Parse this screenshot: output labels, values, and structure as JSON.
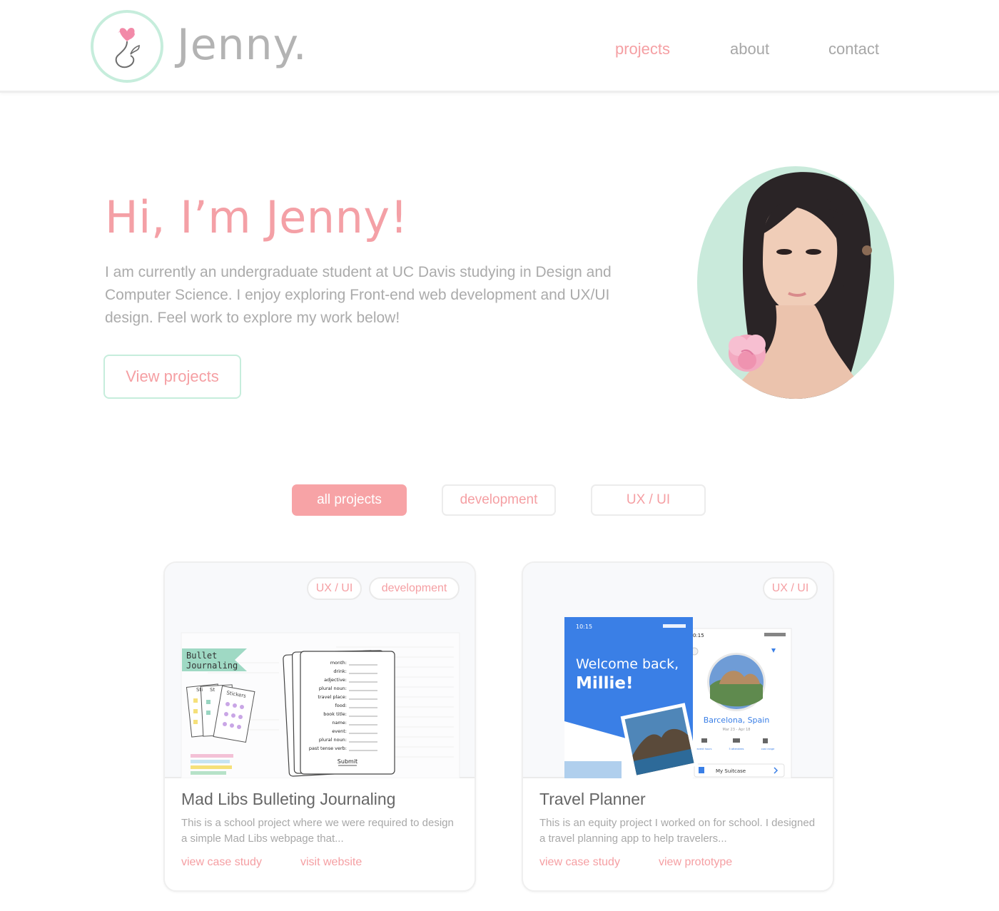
{
  "header": {
    "logo_text": "Jenny.",
    "nav": [
      "projects",
      "about",
      "contact"
    ]
  },
  "hero": {
    "title": "Hi, I’m Jenny!",
    "description": "I am currently an undergraduate student at UC Davis studying in Design and Computer Science. I enjoy exploring Front-end web development and UX/UI design. Feel work to explore my work below!",
    "button": "View projects"
  },
  "filters": [
    "all projects",
    "development",
    "UX / UI"
  ],
  "projects": [
    {
      "tags": [
        "UX / UI",
        "development"
      ],
      "title": "Mad Libs Bulleting Journaling",
      "description": "This is a school project where we were required to design a simple Mad Libs webpage that...",
      "links": [
        "view case study",
        "visit website"
      ],
      "thumb": {
        "banner": "Bullet Journaling",
        "sticker_labels": [
          "Sti",
          "St",
          "Stickers"
        ],
        "form_fields": [
          "month:",
          "drink:",
          "adjective:",
          "plural noun:",
          "travel place:",
          "food:",
          "book title:",
          "name:",
          "event:",
          "plural noun:",
          "past tense verb:"
        ],
        "submit": "Submit"
      }
    },
    {
      "tags": [
        "UX / UI"
      ],
      "title": "Travel Planner",
      "description": "This is an equity project I worked on for school. I designed a travel planning app to help travelers...",
      "links": [
        "view case study",
        "view prototype"
      ],
      "thumb": {
        "time1": "10:15",
        "welcome_line1": "Welcome back,",
        "welcome_line2": "Millie!",
        "time2": "0:15",
        "place": "Barcelona, Spain",
        "dates": "Mar 23 - Apr 18",
        "suitcase": "My Suitcase",
        "icon_labels": [
          "event hours",
          "5 attendees",
          "cost range"
        ]
      }
    }
  ],
  "colors": {
    "accent_pink": "#f59fa3",
    "mint": "#c6eddc",
    "text_gray": "#a8a8a8",
    "app_blue": "#3a7fe6"
  }
}
